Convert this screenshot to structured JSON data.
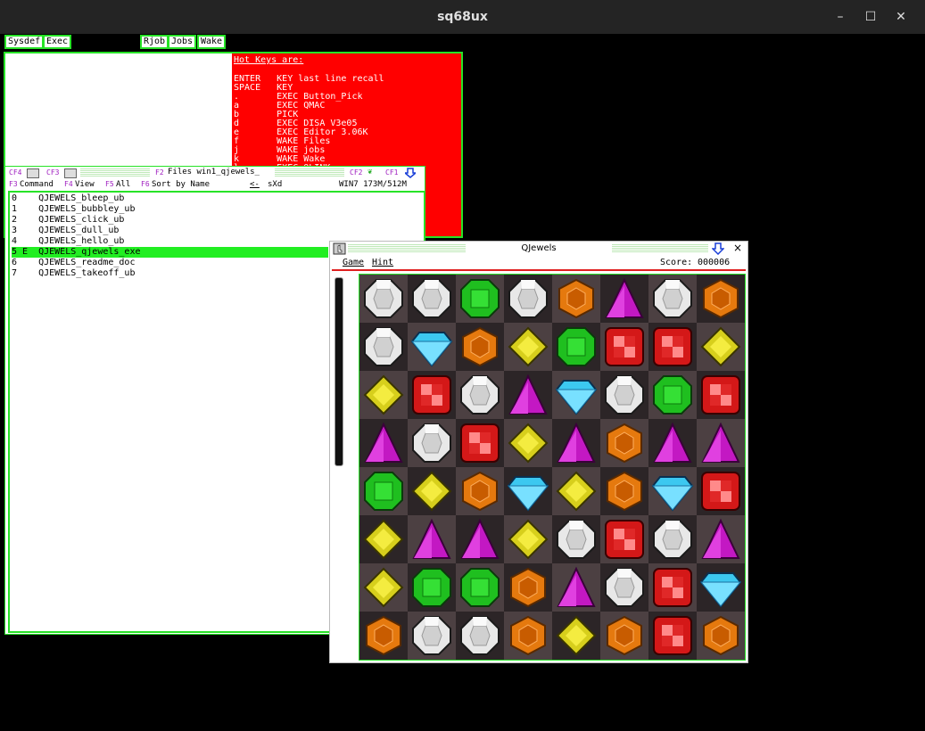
{
  "window": {
    "title": "sq68ux",
    "minimize": "–",
    "maximize": "☐",
    "close": "✕"
  },
  "taskbar": [
    "Sysdef",
    "Exec",
    "Rjob",
    "Jobs",
    "Wake"
  ],
  "hotkeys": {
    "header": "Hot Keys are:",
    "lines": [
      "ENTER   KEY last line recall",
      "SPACE   KEY",
      ".       EXEC Button_Pick",
      "a       EXEC QMAC",
      "b       PICK",
      "d       EXEC DISA V3e05",
      "e       EXEC Editor 3.06K",
      "f       WAKE Files",
      "j       WAKE jobs",
      "k       WAKE Wake",
      "l       EXEC QLINK"
    ]
  },
  "files": {
    "title_keys": {
      "cf4": "CF4",
      "cf3": "CF3",
      "f2": "F2",
      "cf2": "CF2",
      "cf1": "CF1"
    },
    "title": "Files win1_qjewels_",
    "menu": {
      "f3": "F3",
      "command": "Command",
      "f4": "F4",
      "view": "View",
      "f5": "F5",
      "all": "All",
      "f6": "F6",
      "sort": "Sort by Name",
      "back": "<-",
      "sxd": "sXd",
      "status": "WIN7 173M/512M"
    },
    "rows": [
      "0    QJEWELS_bleep_ub",
      "1    QJEWELS_bubbley_ub",
      "2    QJEWELS_click_ub",
      "3    QJEWELS_dull_ub",
      "4    QJEWELS_hello_ub",
      "5 E  QJEWELS_qjewels_exe",
      "6    QJEWELS_readme_doc",
      "7    QJEWELS_takeoff_ub"
    ],
    "selected_row": 5
  },
  "qjewels": {
    "title": "QJewels",
    "close": "×",
    "menu_game": "Game",
    "menu_hint": "Hint",
    "score_label": "Score:",
    "score": "000006",
    "grid": [
      [
        "white",
        "white",
        "green",
        "white",
        "orange",
        "purple",
        "white",
        "orange"
      ],
      [
        "white",
        "blue",
        "orange",
        "yellow",
        "green",
        "red",
        "red",
        "yellow"
      ],
      [
        "yellow",
        "red",
        "white",
        "purple",
        "blue",
        "white",
        "green",
        "red"
      ],
      [
        "purple",
        "white",
        "red",
        "yellow",
        "purple",
        "orange",
        "purple",
        "purple"
      ],
      [
        "green",
        "yellow",
        "orange",
        "blue",
        "yellow",
        "orange",
        "blue",
        "red"
      ],
      [
        "yellow",
        "purple",
        "purple",
        "yellow",
        "white",
        "red",
        "white",
        "purple"
      ],
      [
        "yellow",
        "green",
        "green",
        "orange",
        "purple",
        "white",
        "red",
        "blue"
      ],
      [
        "orange",
        "white",
        "white",
        "orange",
        "yellow",
        "orange",
        "red",
        "orange"
      ]
    ]
  },
  "colors": {
    "accent": "#27e327",
    "hotkeys_bg": "#ff0000",
    "selection": "#22ee22"
  }
}
